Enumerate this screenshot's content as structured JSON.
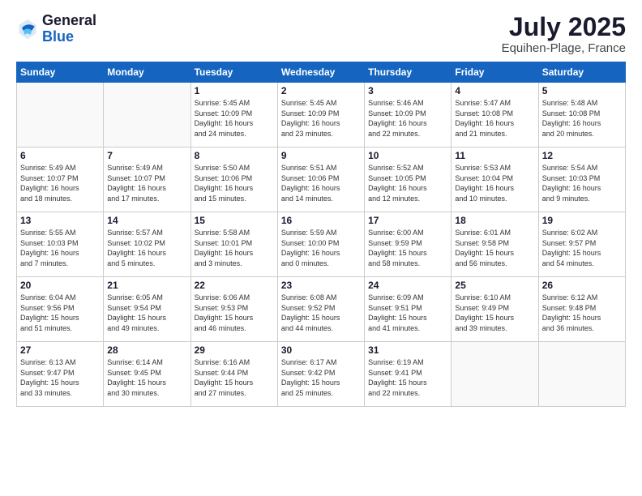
{
  "logo": {
    "general": "General",
    "blue": "Blue"
  },
  "title": "July 2025",
  "location": "Equihen-Plage, France",
  "weekdays": [
    "Sunday",
    "Monday",
    "Tuesday",
    "Wednesday",
    "Thursday",
    "Friday",
    "Saturday"
  ],
  "weeks": [
    [
      {
        "day": "",
        "info": ""
      },
      {
        "day": "",
        "info": ""
      },
      {
        "day": "1",
        "info": "Sunrise: 5:45 AM\nSunset: 10:09 PM\nDaylight: 16 hours\nand 24 minutes."
      },
      {
        "day": "2",
        "info": "Sunrise: 5:45 AM\nSunset: 10:09 PM\nDaylight: 16 hours\nand 23 minutes."
      },
      {
        "day": "3",
        "info": "Sunrise: 5:46 AM\nSunset: 10:09 PM\nDaylight: 16 hours\nand 22 minutes."
      },
      {
        "day": "4",
        "info": "Sunrise: 5:47 AM\nSunset: 10:08 PM\nDaylight: 16 hours\nand 21 minutes."
      },
      {
        "day": "5",
        "info": "Sunrise: 5:48 AM\nSunset: 10:08 PM\nDaylight: 16 hours\nand 20 minutes."
      }
    ],
    [
      {
        "day": "6",
        "info": "Sunrise: 5:49 AM\nSunset: 10:07 PM\nDaylight: 16 hours\nand 18 minutes."
      },
      {
        "day": "7",
        "info": "Sunrise: 5:49 AM\nSunset: 10:07 PM\nDaylight: 16 hours\nand 17 minutes."
      },
      {
        "day": "8",
        "info": "Sunrise: 5:50 AM\nSunset: 10:06 PM\nDaylight: 16 hours\nand 15 minutes."
      },
      {
        "day": "9",
        "info": "Sunrise: 5:51 AM\nSunset: 10:06 PM\nDaylight: 16 hours\nand 14 minutes."
      },
      {
        "day": "10",
        "info": "Sunrise: 5:52 AM\nSunset: 10:05 PM\nDaylight: 16 hours\nand 12 minutes."
      },
      {
        "day": "11",
        "info": "Sunrise: 5:53 AM\nSunset: 10:04 PM\nDaylight: 16 hours\nand 10 minutes."
      },
      {
        "day": "12",
        "info": "Sunrise: 5:54 AM\nSunset: 10:03 PM\nDaylight: 16 hours\nand 9 minutes."
      }
    ],
    [
      {
        "day": "13",
        "info": "Sunrise: 5:55 AM\nSunset: 10:03 PM\nDaylight: 16 hours\nand 7 minutes."
      },
      {
        "day": "14",
        "info": "Sunrise: 5:57 AM\nSunset: 10:02 PM\nDaylight: 16 hours\nand 5 minutes."
      },
      {
        "day": "15",
        "info": "Sunrise: 5:58 AM\nSunset: 10:01 PM\nDaylight: 16 hours\nand 3 minutes."
      },
      {
        "day": "16",
        "info": "Sunrise: 5:59 AM\nSunset: 10:00 PM\nDaylight: 16 hours\nand 0 minutes."
      },
      {
        "day": "17",
        "info": "Sunrise: 6:00 AM\nSunset: 9:59 PM\nDaylight: 15 hours\nand 58 minutes."
      },
      {
        "day": "18",
        "info": "Sunrise: 6:01 AM\nSunset: 9:58 PM\nDaylight: 15 hours\nand 56 minutes."
      },
      {
        "day": "19",
        "info": "Sunrise: 6:02 AM\nSunset: 9:57 PM\nDaylight: 15 hours\nand 54 minutes."
      }
    ],
    [
      {
        "day": "20",
        "info": "Sunrise: 6:04 AM\nSunset: 9:56 PM\nDaylight: 15 hours\nand 51 minutes."
      },
      {
        "day": "21",
        "info": "Sunrise: 6:05 AM\nSunset: 9:54 PM\nDaylight: 15 hours\nand 49 minutes."
      },
      {
        "day": "22",
        "info": "Sunrise: 6:06 AM\nSunset: 9:53 PM\nDaylight: 15 hours\nand 46 minutes."
      },
      {
        "day": "23",
        "info": "Sunrise: 6:08 AM\nSunset: 9:52 PM\nDaylight: 15 hours\nand 44 minutes."
      },
      {
        "day": "24",
        "info": "Sunrise: 6:09 AM\nSunset: 9:51 PM\nDaylight: 15 hours\nand 41 minutes."
      },
      {
        "day": "25",
        "info": "Sunrise: 6:10 AM\nSunset: 9:49 PM\nDaylight: 15 hours\nand 39 minutes."
      },
      {
        "day": "26",
        "info": "Sunrise: 6:12 AM\nSunset: 9:48 PM\nDaylight: 15 hours\nand 36 minutes."
      }
    ],
    [
      {
        "day": "27",
        "info": "Sunrise: 6:13 AM\nSunset: 9:47 PM\nDaylight: 15 hours\nand 33 minutes."
      },
      {
        "day": "28",
        "info": "Sunrise: 6:14 AM\nSunset: 9:45 PM\nDaylight: 15 hours\nand 30 minutes."
      },
      {
        "day": "29",
        "info": "Sunrise: 6:16 AM\nSunset: 9:44 PM\nDaylight: 15 hours\nand 27 minutes."
      },
      {
        "day": "30",
        "info": "Sunrise: 6:17 AM\nSunset: 9:42 PM\nDaylight: 15 hours\nand 25 minutes."
      },
      {
        "day": "31",
        "info": "Sunrise: 6:19 AM\nSunset: 9:41 PM\nDaylight: 15 hours\nand 22 minutes."
      },
      {
        "day": "",
        "info": ""
      },
      {
        "day": "",
        "info": ""
      }
    ]
  ]
}
